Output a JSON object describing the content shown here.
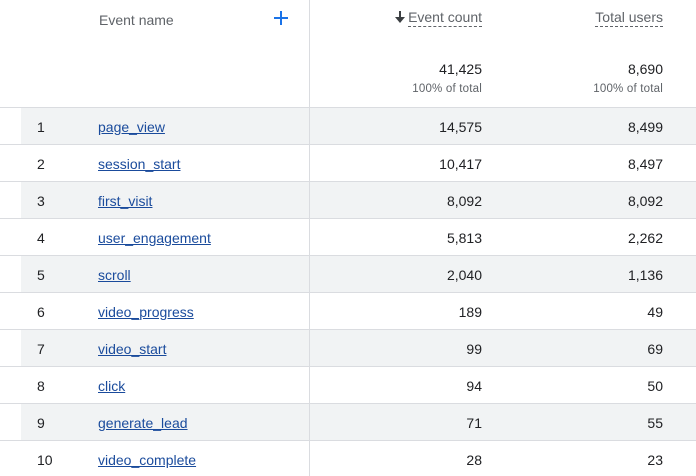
{
  "header": {
    "event_name_label": "Event name",
    "add_icon": "plus-icon",
    "event_count_label": "Event count",
    "total_users_label": "Total users",
    "sort_icon": "arrow-down-icon",
    "sort_direction": "descending",
    "accent_color": "#1a73e8"
  },
  "totals": {
    "event_count": "41,425",
    "event_count_pct": "100% of total",
    "total_users": "8,690",
    "total_users_pct": "100% of total"
  },
  "rows": [
    {
      "index": "1",
      "name": "page_view",
      "event_count": "14,575",
      "total_users": "8,499"
    },
    {
      "index": "2",
      "name": "session_start",
      "event_count": "10,417",
      "total_users": "8,497"
    },
    {
      "index": "3",
      "name": "first_visit",
      "event_count": "8,092",
      "total_users": "8,092"
    },
    {
      "index": "4",
      "name": "user_engagement",
      "event_count": "5,813",
      "total_users": "2,262"
    },
    {
      "index": "5",
      "name": "scroll",
      "event_count": "2,040",
      "total_users": "1,136"
    },
    {
      "index": "6",
      "name": "video_progress",
      "event_count": "189",
      "total_users": "49"
    },
    {
      "index": "7",
      "name": "video_start",
      "event_count": "99",
      "total_users": "69"
    },
    {
      "index": "8",
      "name": "click",
      "event_count": "94",
      "total_users": "50"
    },
    {
      "index": "9",
      "name": "generate_lead",
      "event_count": "71",
      "total_users": "55"
    },
    {
      "index": "10",
      "name": "video_complete",
      "event_count": "28",
      "total_users": "23"
    }
  ]
}
